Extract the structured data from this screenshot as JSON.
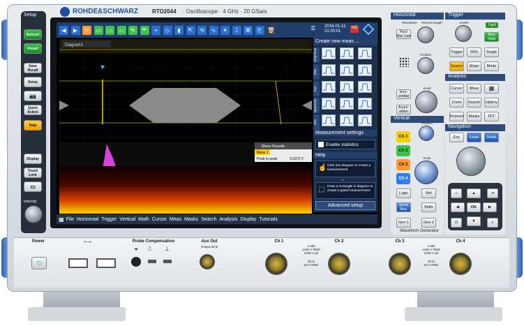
{
  "brand": {
    "name": "ROHDE&SCHWARZ",
    "model": "RTO2044",
    "type": "Oscilloscope",
    "bandwidth": "4 GHz",
    "sample_rate": "20 GSa/s"
  },
  "left_panel": {
    "title": "Setup",
    "buttons": [
      "Autoset",
      "Preset",
      "Save\nRecall",
      "Setup",
      "",
      "Quick\nAction",
      "Help",
      "Display",
      "Touch\nLock",
      ""
    ],
    "intensity": "Intensity"
  },
  "screen": {
    "date": "2016-01-21",
    "time": "21:00:01",
    "diagram_title": "Diagram1",
    "meas_results_title": "Meas Results",
    "meas_row": {
      "name": "Meas 1",
      "param": "Peak to peak",
      "value": "3.3372 V"
    },
    "menu": [
      "File",
      "Horizontal",
      "Trigger",
      "Vertical",
      "Math",
      "Cursor",
      "Meas",
      "Masks",
      "Search",
      "Analysis",
      "Display",
      "Tutorials"
    ],
    "right_panel": {
      "create_title": "Create new meas ...",
      "categories": [
        "Amp/Time",
        "Jitter",
        "Eye",
        "Spectrum",
        "Hist"
      ],
      "meas_settings": "Measurement settings",
      "enable_stats": "Enable statistics",
      "help": "Help",
      "help1": "Click into diagram to create a measurement",
      "or": "or",
      "help2": "Draw a rectangle in diagram to create a gated measurement",
      "advanced": "Advanced setup"
    }
  },
  "horizontal": {
    "title": "Horizontal",
    "resolution": "Resolution",
    "record_length": "Record Length",
    "res_rec_len": "Res/\nRec Len",
    "position": "Position",
    "scale": "Scale",
    "horizontal_btn": "Hori-\nzontal",
    "acquisition": "Acqui-\nsition"
  },
  "vertical": {
    "title": "Vertical",
    "position": "Position",
    "scale": "Scale",
    "ch1": "Ch 1",
    "ch2": "Ch 2",
    "ch3": "Ch 3",
    "ch4": "Ch 4",
    "logic": "Logic",
    "ref": "Ref",
    "serial_bus": "Serial\nBus",
    "math": "Math",
    "gen1": "Gen 1",
    "gen2": "Gen 2",
    "waveform_generator": "Waveform Generator"
  },
  "trigger": {
    "title": "Trigger",
    "levels": "Levels",
    "trig": "Trig'd",
    "run_stop": "Run\nStop",
    "trigger": "Trigger",
    "fifty": "50%",
    "single": "Single",
    "source": "Source",
    "slope": "Slope",
    "mode": "Mode"
  },
  "analysis": {
    "title": "Analysis",
    "cursor": "Cursor",
    "meas": "Meas",
    "zoom": "Zoom",
    "search": "Search",
    "history": "History",
    "protocol": "Protocol",
    "masks": "Masks",
    "fft": "FFT"
  },
  "navigation": {
    "title": "Navigation",
    "esc": "Esc",
    "undo": "Undo",
    "redo": "Redo",
    "ok": "OK"
  },
  "bottom": {
    "power": "Power",
    "probe_compensation": "Probe Compensation",
    "aux_out": "Aux Out",
    "aux_out_sub": "Output 50 Ω",
    "ch1": "Ch 1",
    "ch2": "Ch 2",
    "ch3": "Ch 3",
    "ch4": "Ch 4",
    "spec_a": "1 MΩ\n≤150 V RMS\n≤200 V pk",
    "spec_b": "50 Ω\n≤5 V RMS"
  },
  "colors": {
    "ch1": "#f5d000",
    "ch2": "#3ec24b",
    "ch3": "#ff9a2e",
    "ch4": "#2f7df2",
    "accent": "#1e4f9e"
  }
}
